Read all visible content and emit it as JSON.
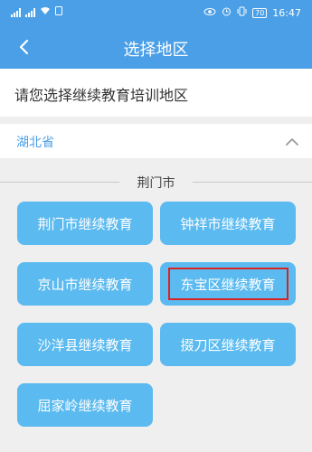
{
  "status_bar": {
    "battery": "70",
    "time": "16:47"
  },
  "header": {
    "title": "选择地区",
    "back_icon": "chevron-left-icon"
  },
  "instruction": "请您选择继续教育培训地区",
  "province": {
    "name": "湖北省",
    "toggle_icon": "chevron-up-icon"
  },
  "city_section": {
    "city": "荆门市",
    "buttons": [
      "荆门市继续教育",
      "钟祥市继续教育",
      "京山市继续教育",
      "东宝区继续教育",
      "沙洋县继续教育",
      "掇刀区继续教育",
      "屈家岭继续教育"
    ]
  },
  "colors": {
    "primary": "#4a9fe6",
    "button": "#5bbaef",
    "highlight": "#d92323"
  }
}
